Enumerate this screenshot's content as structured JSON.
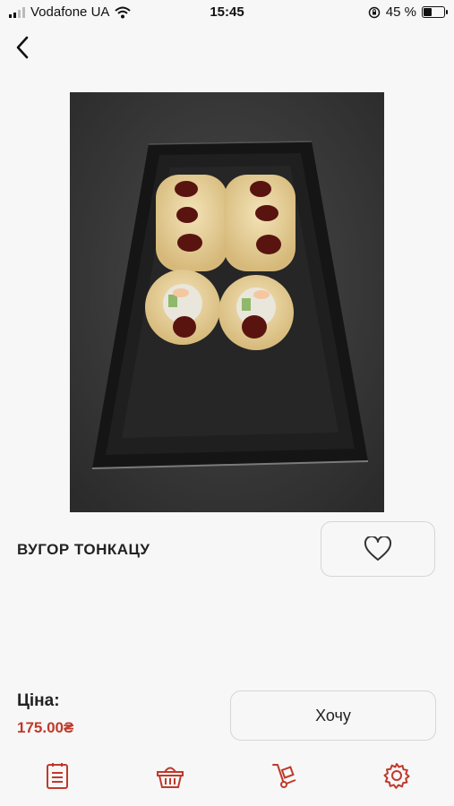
{
  "status_bar": {
    "carrier": "Vodafone UA",
    "time": "15:45",
    "battery_percent_text": "45 %",
    "battery_level": 0.45
  },
  "navigation": {
    "back_icon": "chevron-left-icon"
  },
  "product": {
    "image_description_icon": "product-photo",
    "title": "ВУГОР ТОНКАЦУ",
    "favorite_icon": "heart-outline-icon"
  },
  "price": {
    "label": "Ціна:",
    "value": "175.00₴"
  },
  "actions": {
    "want_label": "Хочу"
  },
  "tab_bar": {
    "items": [
      {
        "icon": "menu-list-icon"
      },
      {
        "icon": "basket-icon"
      },
      {
        "icon": "delivery-cart-icon"
      },
      {
        "icon": "settings-gear-icon"
      }
    ]
  },
  "colors": {
    "accent": "#c0392b",
    "background": "#f7f7f7",
    "border": "#d6d6d6"
  }
}
